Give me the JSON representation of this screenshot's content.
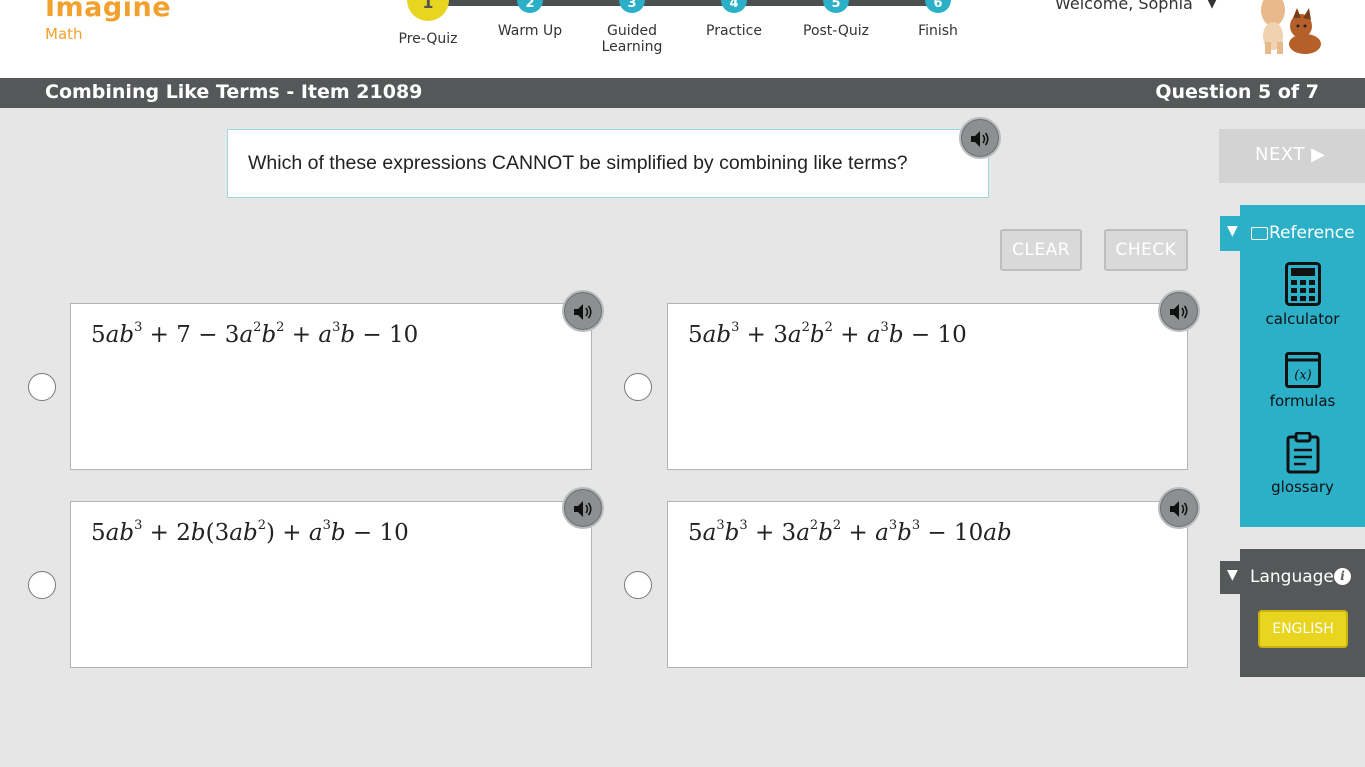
{
  "header": {
    "logo_imagine": "Imagine",
    "logo_math": "Math",
    "welcome": "Welcome, Sophia",
    "welcome_caret": "▼",
    "steps": [
      {
        "number": "1",
        "label": "Pre-Quiz",
        "active": true
      },
      {
        "number": "2",
        "label": "Warm Up",
        "active": false
      },
      {
        "number": "3",
        "label": "Guided\nLearning",
        "active": false
      },
      {
        "number": "4",
        "label": "Practice",
        "active": false
      },
      {
        "number": "5",
        "label": "Post-Quiz",
        "active": false
      },
      {
        "number": "6",
        "label": "Finish",
        "active": false
      }
    ]
  },
  "title_bar": {
    "title": "Combining Like Terms - Item 21089",
    "counter": "Question 5 of 7"
  },
  "question": {
    "prompt": "Which of these expressions CANNOT be simplified by combining like terms?"
  },
  "actions": {
    "clear": "CLEAR",
    "check": "CHECK",
    "next": "NEXT ▶"
  },
  "answers": [
    {
      "id": "a",
      "expression": "5ab^3 + 7 − 3a^2b^2 + a^3b − 10"
    },
    {
      "id": "b",
      "expression": "5ab^3 + 3a^2b^2 + a^3b − 10"
    },
    {
      "id": "c",
      "expression": "5ab^3 + 2b(3ab^2) + a^3b − 10"
    },
    {
      "id": "d",
      "expression": "5a^3b^3 + 3a^2b^2 + a^3b^3 − 10ab"
    }
  ],
  "reference": {
    "tab_label": "Reference",
    "tab_toggle": "▼",
    "tools": [
      {
        "label": "calculator",
        "icon": "calculator-icon"
      },
      {
        "label": "formulas",
        "icon": "formulas-icon"
      },
      {
        "label": "glossary",
        "icon": "glossary-icon"
      }
    ]
  },
  "language": {
    "tab_label": "Language",
    "tab_toggle": "▼",
    "info": "i",
    "selected": "ENGLISH"
  },
  "colors": {
    "brand_orange": "#f2a12c",
    "teal": "#2bb0c8",
    "yellow": "#e9d420",
    "dark_bar": "#545859"
  }
}
